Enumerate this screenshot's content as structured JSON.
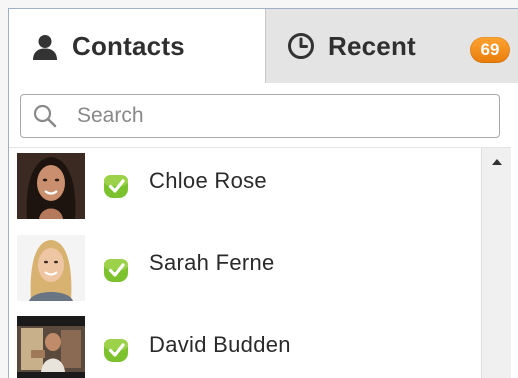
{
  "tabs": [
    {
      "label": "Contacts",
      "icon": "person-icon",
      "active": true
    },
    {
      "label": "Recent",
      "icon": "clock-icon",
      "active": false,
      "badge": "69"
    }
  ],
  "search": {
    "placeholder": "Search",
    "value": ""
  },
  "contacts": [
    {
      "name": "Chloe Rose",
      "status": "online",
      "avatar": "avatar-photo"
    },
    {
      "name": "Sarah Ferne",
      "status": "online",
      "avatar": "avatar-photo"
    },
    {
      "name": "David Budden",
      "status": "online",
      "avatar": "avatar-photo"
    }
  ],
  "colors": {
    "badge": "#f58a16",
    "status_online": "#7cc22f",
    "frame_border": "#9fb0c8",
    "tab_inactive": "#e4e4e4"
  },
  "scrollbar": {
    "up_icon": "scroll-up-arrow-icon"
  }
}
